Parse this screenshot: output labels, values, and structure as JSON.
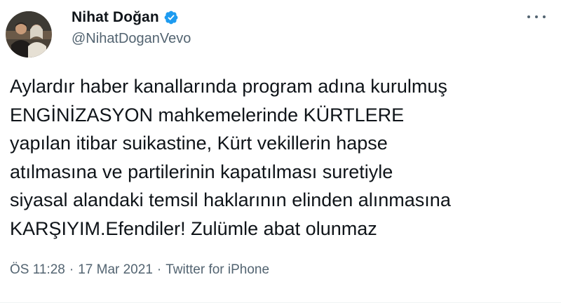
{
  "author": {
    "display_name": "Nihat Doğan",
    "handle": "@NihatDoganVevo",
    "verified": true,
    "avatar_icon": "profile-photo"
  },
  "tweet": {
    "text": "Aylardır haber kanallarında program adına kurulmuş\nENGİNİZASYON mahkemelerinde KÜRTLERE\nyapılan itibar suikastine, Kürt vekillerin hapse\natılmasına ve partilerinin kapatılması suretiyle\nsiyasal alandaki temsil haklarının elinden alınmasına\nKARŞIYIM.Efendiler! Zulümle abat olunmaz"
  },
  "meta": {
    "time": "ÖS 11:28",
    "separator": "·",
    "date": "17 Mar 2021",
    "source": "Twitter for iPhone"
  },
  "colors": {
    "text": "#0f1419",
    "secondary": "#536471",
    "verified_blue": "#1d9bf0"
  }
}
